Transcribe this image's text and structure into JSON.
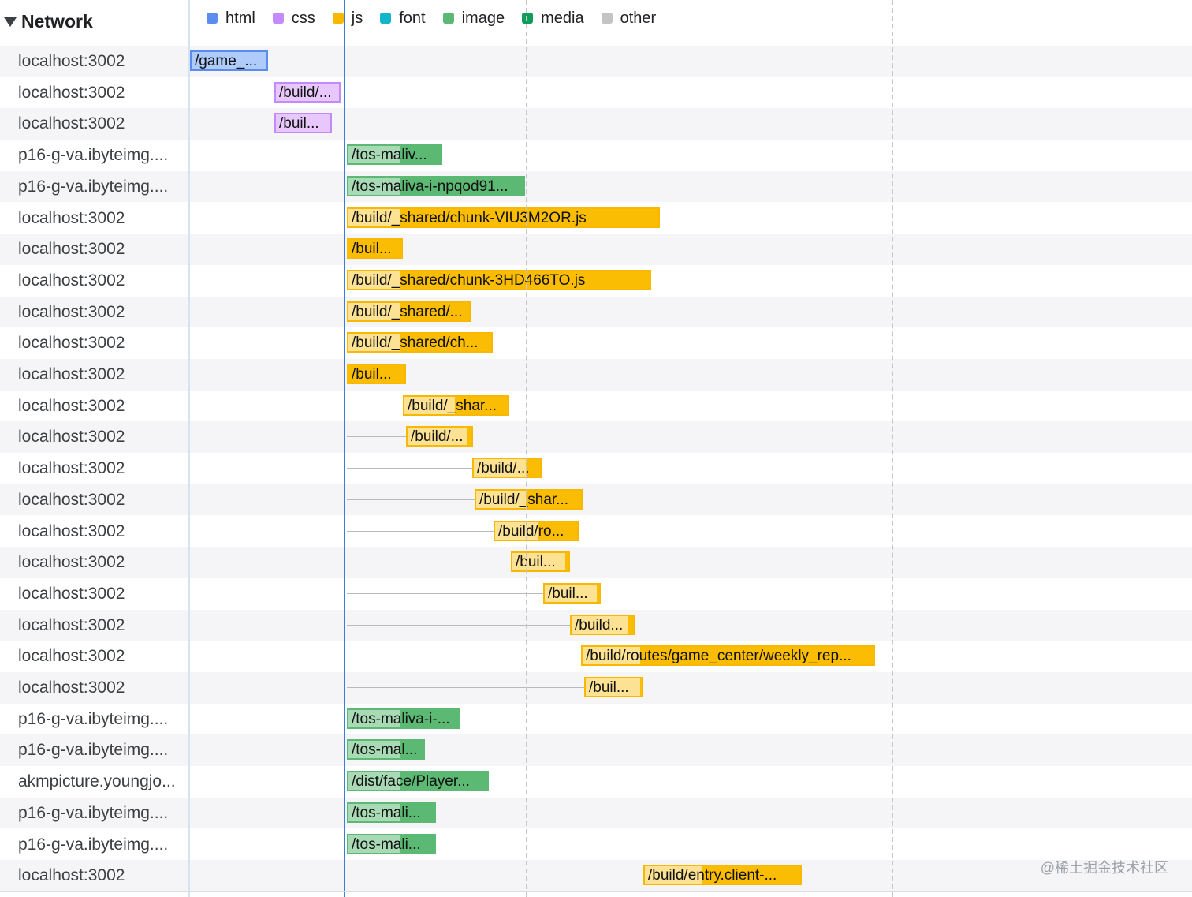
{
  "panel": {
    "title": "Network",
    "watermark": "@稀土掘金技术社区"
  },
  "legend": [
    {
      "label": "html",
      "color": "#5b8def",
      "icon": "html-swatch-icon"
    },
    {
      "label": "css",
      "color": "#c58af9",
      "icon": "css-swatch-icon"
    },
    {
      "label": "js",
      "color": "#f9b800",
      "icon": "js-swatch-icon"
    },
    {
      "label": "font",
      "color": "#12b5cb",
      "icon": "font-swatch-icon"
    },
    {
      "label": "image",
      "color": "#5bb974",
      "icon": "image-swatch-icon"
    },
    {
      "label": "media",
      "color": "#0f9d58",
      "icon": "media-swatch-icon"
    },
    {
      "label": "other",
      "color": "#c4c4c4",
      "icon": "other-swatch-icon"
    }
  ],
  "type_colors": {
    "html": {
      "solid": "#aecbfa",
      "light": "#aecbfa",
      "border": "#5b8def"
    },
    "css": {
      "solid": "#e8c8fc",
      "light": "#e8c8fc",
      "border": "#c58af9"
    },
    "js": {
      "solid": "#fbbc04",
      "light": "#fde293",
      "border": "#f9b800"
    },
    "image": {
      "solid": "#5bb974",
      "light": "#a8dab5",
      "border": "#5bb974"
    }
  },
  "requests": [
    {
      "domain": "localhost:3002",
      "label": "/game_...",
      "type": "html"
    },
    {
      "domain": "localhost:3002",
      "label": "/build/...",
      "type": "css"
    },
    {
      "domain": "localhost:3002",
      "label": "/buil...",
      "type": "css"
    },
    {
      "domain": "p16-g-va.ibyteimg....",
      "label": "/tos-maliv...",
      "type": "image"
    },
    {
      "domain": "p16-g-va.ibyteimg....",
      "label": "/tos-maliva-i-npqod91...",
      "type": "image"
    },
    {
      "domain": "localhost:3002",
      "label": "/build/_shared/chunk-VIU3M2OR.js",
      "type": "js"
    },
    {
      "domain": "localhost:3002",
      "label": "/buil...",
      "type": "js"
    },
    {
      "domain": "localhost:3002",
      "label": "/build/_shared/chunk-3HD466TO.js",
      "type": "js"
    },
    {
      "domain": "localhost:3002",
      "label": "/build/_shared/...",
      "type": "js"
    },
    {
      "domain": "localhost:3002",
      "label": "/build/_shared/ch...",
      "type": "js"
    },
    {
      "domain": "localhost:3002",
      "label": "/buil...",
      "type": "js"
    },
    {
      "domain": "localhost:3002",
      "label": "/build/_shar...",
      "type": "js"
    },
    {
      "domain": "localhost:3002",
      "label": "/build/...",
      "type": "js"
    },
    {
      "domain": "localhost:3002",
      "label": "/build/...",
      "type": "js"
    },
    {
      "domain": "localhost:3002",
      "label": "/build/_shar...",
      "type": "js"
    },
    {
      "domain": "localhost:3002",
      "label": "/build/ro...",
      "type": "js"
    },
    {
      "domain": "localhost:3002",
      "label": "/buil...",
      "type": "js"
    },
    {
      "domain": "localhost:3002",
      "label": "/buil...",
      "type": "js"
    },
    {
      "domain": "localhost:3002",
      "label": "/build...",
      "type": "js"
    },
    {
      "domain": "localhost:3002",
      "label": "/build/routes/game_center/weekly_rep...",
      "type": "js"
    },
    {
      "domain": "localhost:3002",
      "label": "/buil...",
      "type": "js"
    },
    {
      "domain": "p16-g-va.ibyteimg....",
      "label": "/tos-maliva-i-...",
      "type": "image"
    },
    {
      "domain": "p16-g-va.ibyteimg....",
      "label": "/tos-mal...",
      "type": "image"
    },
    {
      "domain": "akmpicture.youngjo...",
      "label": "/dist/face/Player...",
      "type": "image"
    },
    {
      "domain": "p16-g-va.ibyteimg....",
      "label": "/tos-mali...",
      "type": "image"
    },
    {
      "domain": "p16-g-va.ibyteimg....",
      "label": "/tos-mali...",
      "type": "image"
    },
    {
      "domain": "localhost:3002",
      "label": "/build/entry.client-...",
      "type": "js"
    }
  ]
}
